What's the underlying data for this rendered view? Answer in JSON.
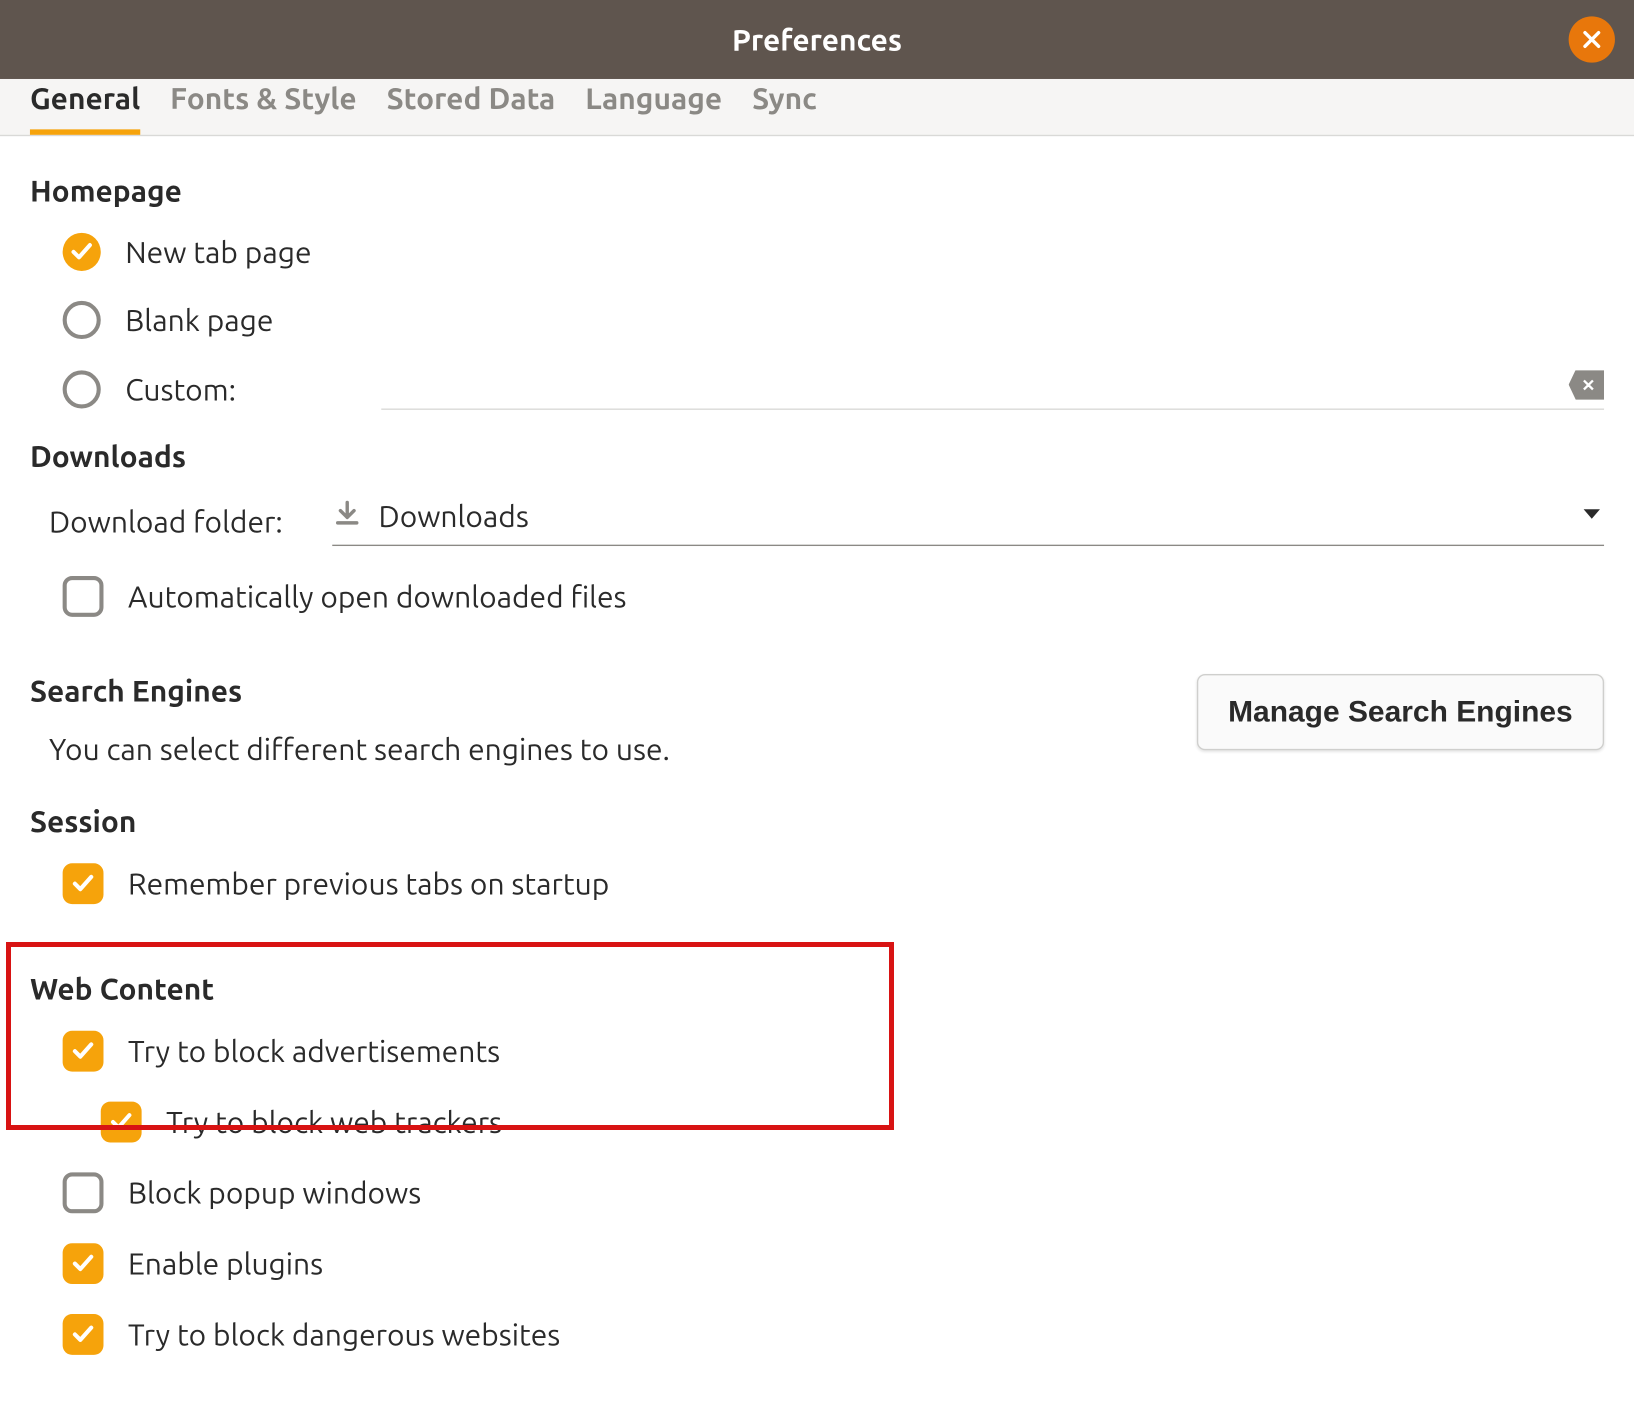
{
  "titlebar": {
    "title": "Preferences"
  },
  "tabs": {
    "general": "General",
    "fonts": "Fonts & Style",
    "stored": "Stored Data",
    "language": "Language",
    "sync": "Sync"
  },
  "homepage": {
    "title": "Homepage",
    "new_tab": "New tab page",
    "blank": "Blank page",
    "custom": "Custom:"
  },
  "downloads": {
    "title": "Downloads",
    "folder_label": "Download folder:",
    "folder_value": "Downloads",
    "auto_open": "Automatically open downloaded files"
  },
  "search": {
    "title": "Search Engines",
    "desc": "You can select different search engines to use.",
    "manage": "Manage Search Engines"
  },
  "session": {
    "title": "Session",
    "remember": "Remember previous tabs on startup"
  },
  "web": {
    "title": "Web Content",
    "block_ads": "Try to block advertisements",
    "block_trackers": "Try to block web trackers",
    "block_popups": "Block popup windows",
    "enable_plugins": "Enable plugins",
    "block_dangerous": "Try to block dangerous websites"
  }
}
